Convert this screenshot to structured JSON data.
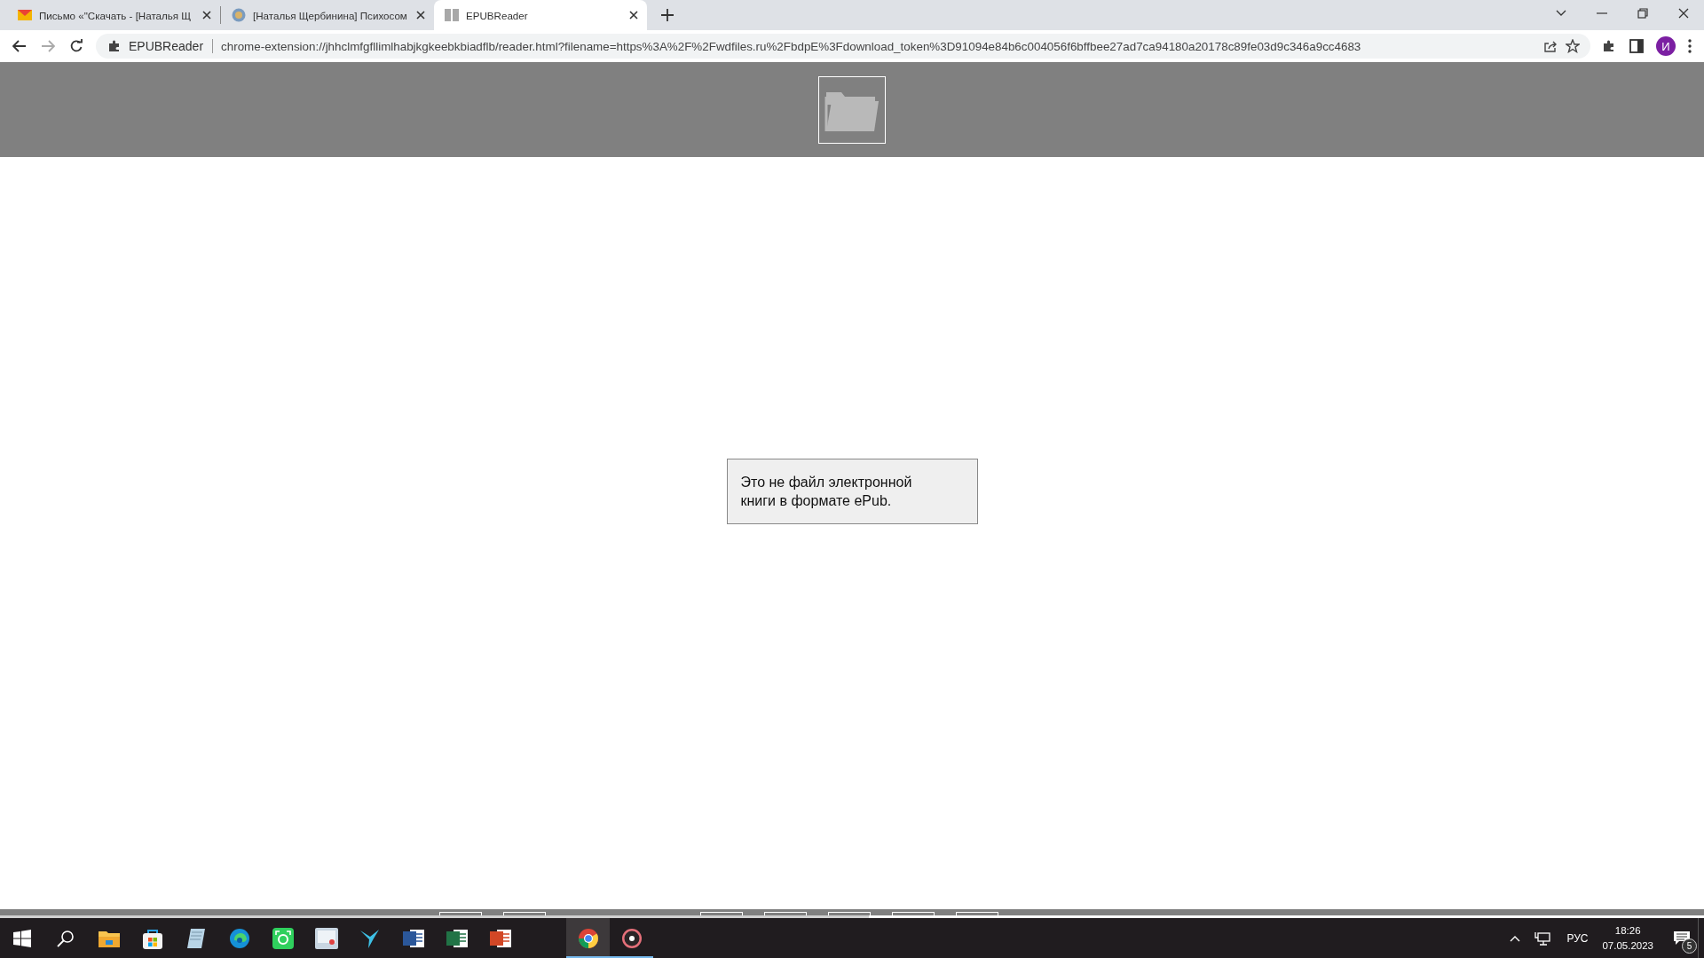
{
  "browser": {
    "tabs": [
      {
        "title": "Письмо «\"Скачать - [Наталья Щ",
        "kind": "mail",
        "selected": false
      },
      {
        "title": "[Наталья Щербинина] Психосом",
        "kind": "globe",
        "selected": false
      },
      {
        "title": "EPUBReader",
        "kind": "book",
        "selected": true
      }
    ],
    "address_bar": {
      "site_label": "EPUBReader",
      "url": "chrome-extension://jhhclmfgfllimlhabjkgkeebkbiadflb/reader.html?filename=https%3A%2F%2Fwdfiles.ru%2FbdpE%3Fdownload_token%3D91094e84b6c004056f6bffbee27ad7ca94180a20178c89fe03d9c346a9cc4683"
    },
    "profile_initial": "И"
  },
  "reader": {
    "message": "Это не файл электронной книги в формате ePub."
  },
  "taskbar": {
    "pinned_apps": [
      {
        "kind": "explorer",
        "running": false,
        "selected": false
      },
      {
        "kind": "store",
        "running": false,
        "selected": false
      },
      {
        "kind": "notepad",
        "running": false,
        "selected": false
      },
      {
        "kind": "edge",
        "running": false,
        "selected": false
      },
      {
        "kind": "screenshot",
        "running": false,
        "selected": false
      },
      {
        "kind": "presentation",
        "running": false,
        "selected": false
      },
      {
        "kind": "bird",
        "running": false,
        "selected": false
      },
      {
        "kind": "word",
        "running": false,
        "selected": false
      },
      {
        "kind": "excel",
        "running": false,
        "selected": false
      },
      {
        "kind": "powerpoint",
        "running": false,
        "selected": false
      }
    ],
    "open_apps": [
      {
        "kind": "chrome",
        "running": true,
        "selected": true
      },
      {
        "kind": "recorder",
        "running": true,
        "selected": false
      }
    ],
    "language": "РУС",
    "time": "18:26",
    "date": "07.05.2023",
    "notification_count": "5"
  }
}
